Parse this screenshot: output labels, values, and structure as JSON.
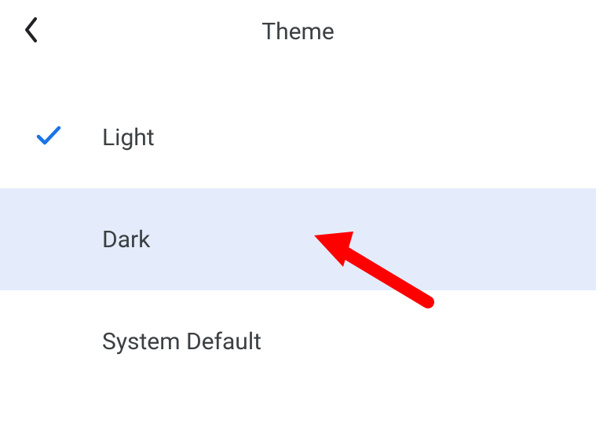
{
  "header": {
    "title": "Theme"
  },
  "options": [
    {
      "label": "Light",
      "selected": true,
      "highlighted": false
    },
    {
      "label": "Dark",
      "selected": false,
      "highlighted": true
    },
    {
      "label": "System Default",
      "selected": false,
      "highlighted": false
    }
  ],
  "colors": {
    "highlight": "#e4ecfb",
    "check": "#1a73e8",
    "text": "#3c4043",
    "arrow": "#ff0000"
  }
}
